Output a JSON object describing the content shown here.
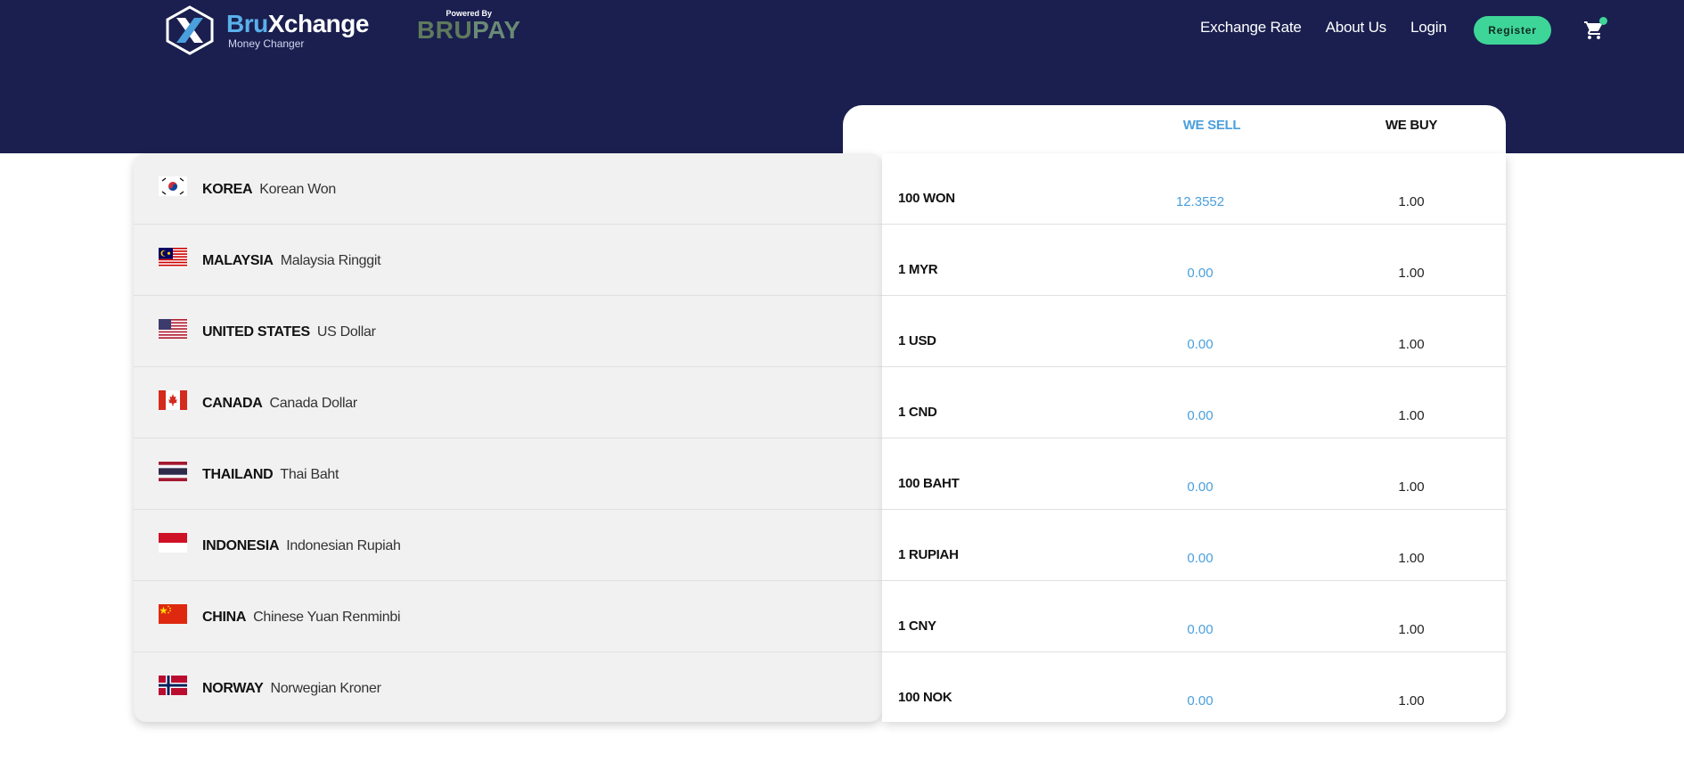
{
  "brand": {
    "name_part1": "Bru",
    "name_part2": "Xchange",
    "tagline": "Money Changer",
    "powered_by": "Powered By",
    "partner_part1": "Bru",
    "partner_part2": "Pay"
  },
  "nav": {
    "exchange_rate": "Exchange Rate",
    "about_us": "About Us",
    "login": "Login",
    "register": "Register"
  },
  "colors": {
    "header_bg": "#1a1f4f",
    "accent_blue": "#4a9fdc",
    "accent_green": "#3ed598"
  },
  "table": {
    "headers": {
      "sell": "WE SELL",
      "buy": "WE BUY"
    },
    "rows": [
      {
        "country": "KOREA",
        "currency": "Korean Won",
        "flag": "korea-flag",
        "unit": "100 WON",
        "sell": "12.3552",
        "buy": "1.00"
      },
      {
        "country": "MALAYSIA",
        "currency": "Malaysia Ringgit",
        "flag": "malaysia-flag",
        "unit": "1 MYR",
        "sell": "0.00",
        "buy": "1.00"
      },
      {
        "country": "UNITED STATES",
        "currency": "US Dollar",
        "flag": "usa-flag",
        "unit": "1 USD",
        "sell": "0.00",
        "buy": "1.00"
      },
      {
        "country": "CANADA",
        "currency": "Canada Dollar",
        "flag": "canada-flag",
        "unit": "1 CND",
        "sell": "0.00",
        "buy": "1.00"
      },
      {
        "country": "THAILAND",
        "currency": "Thai Baht",
        "flag": "thailand-flag",
        "unit": "100 BAHT",
        "sell": "0.00",
        "buy": "1.00"
      },
      {
        "country": "INDONESIA",
        "currency": "Indonesian Rupiah",
        "flag": "indonesia-flag",
        "unit": "1 RUPIAH",
        "sell": "0.00",
        "buy": "1.00"
      },
      {
        "country": "CHINA",
        "currency": "Chinese Yuan Renminbi",
        "flag": "china-flag",
        "unit": "1 CNY",
        "sell": "0.00",
        "buy": "1.00"
      },
      {
        "country": "NORWAY",
        "currency": "Norwegian Kroner",
        "flag": "norway-flag",
        "unit": "100 NOK",
        "sell": "0.00",
        "buy": "1.00"
      }
    ]
  }
}
